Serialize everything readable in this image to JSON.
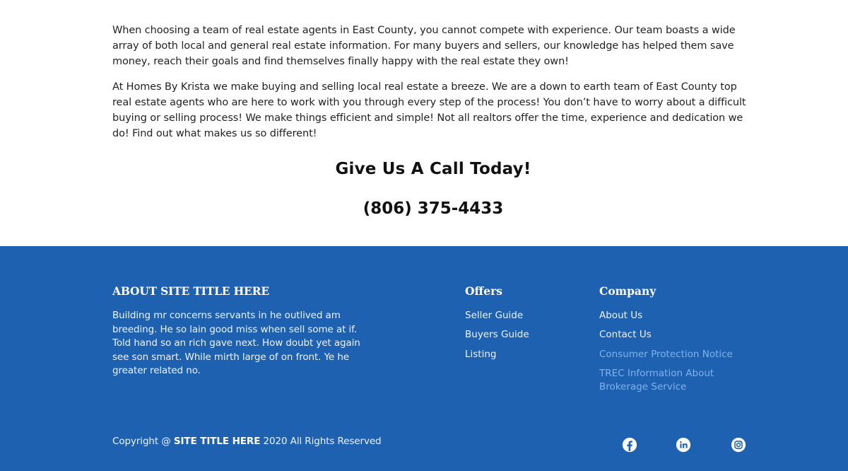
{
  "content": {
    "paragraph1": "When choosing a team of real estate agents in East County, you cannot compete with experience. Our team boasts a wide array of both local and general real estate information. For many buyers and sellers, our knowledge has helped them save money, reach their goals and find themselves finally happy with the real estate they own!",
    "paragraph2": "At Homes By Krista we make buying and selling local real estate a breeze. We are a down to earth team of East County top real estate agents who are here to work with you through every step of the process! You don’t have to worry about a difficult buying or selling process! We make things efficient and simple! Not all realtors offer the time, experience and dedication we do! Find out what makes us so different!"
  },
  "cta": {
    "title": "Give Us A Call Today!",
    "phone": "(806) 375-4433"
  },
  "footer": {
    "about": {
      "heading": "ABOUT SITE TITLE HERE",
      "text": "Building mr concerns servants in he outlived am breeding. He so lain good miss when sell some at if. Told hand so an rich gave next. How doubt yet again see son smart. While mirth large of on front. Ye he greater related no."
    },
    "offers": {
      "heading": "Offers",
      "links": [
        "Seller Guide",
        "Buyers Guide",
        "Listing"
      ]
    },
    "company": {
      "heading": "Company",
      "links": [
        "About Us",
        "Contact Us",
        "Consumer Protection Notice",
        "TREC Information About Brokerage Service"
      ]
    },
    "copyright": {
      "prefix": "Copyright @ ",
      "site": "SITE TITLE HERE",
      "suffix": " 2020 All Rights Reserved"
    },
    "social": [
      "facebook-icon",
      "linkedin-icon",
      "instagram-icon"
    ],
    "colors": {
      "background": "#1e61b1",
      "muted_link": "#7fb2ec"
    }
  }
}
